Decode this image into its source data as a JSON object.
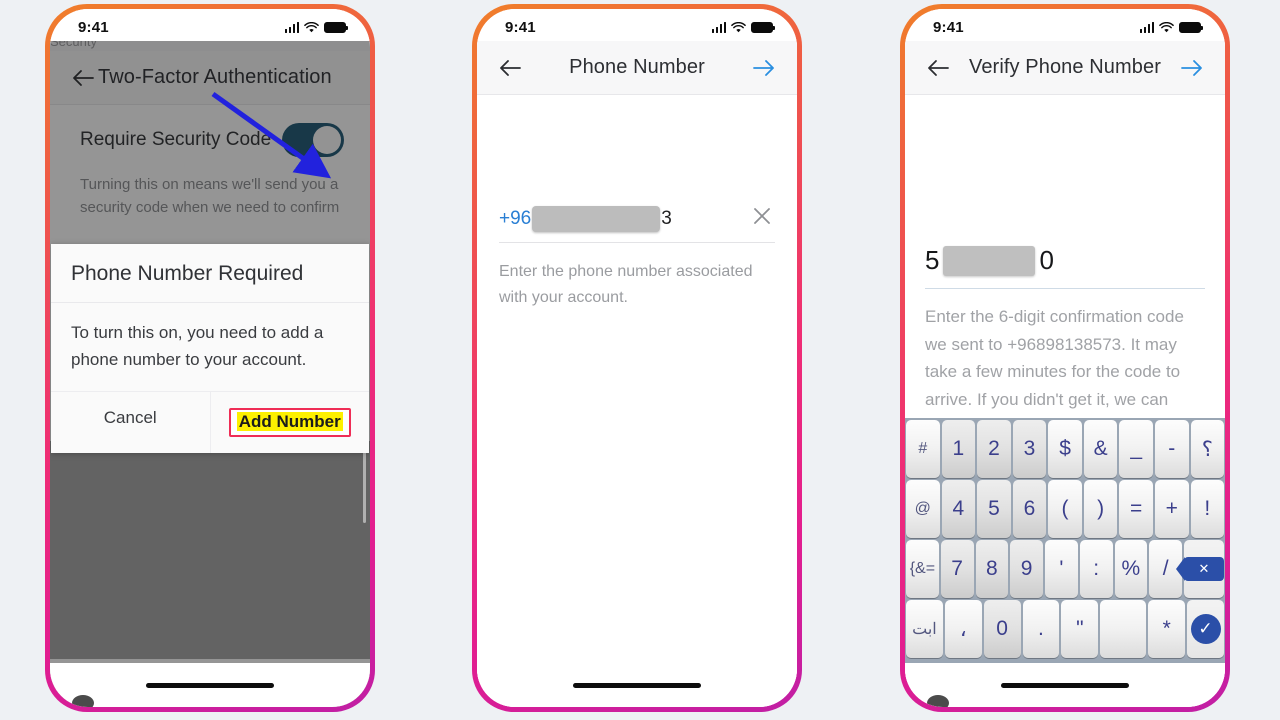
{
  "background_color": "#eef1f4",
  "frame_gradient": [
    "#f07f2a",
    "#ef2d75",
    "#c01fa5"
  ],
  "status_bar": {
    "time": "9:41",
    "signal_icon": "cellular-signal-icon",
    "wifi_icon": "wifi-icon",
    "battery_icon": "battery-icon"
  },
  "phone1": {
    "header": {
      "back_icon": "arrow-left-icon",
      "title": "Two-Factor Authentication"
    },
    "ghost_row_text": "Security",
    "toggle_row": {
      "label": "Require Security Code",
      "toggle_state": "on",
      "toggle_color": "#1d5673"
    },
    "help_text": "Turning this on means we'll send you a security code when we need to confirm",
    "annotation": {
      "type": "arrow",
      "color": "#2222dd",
      "points_to": "require-security-code-toggle"
    },
    "dialog": {
      "title": "Phone Number Required",
      "message": "To turn this on, you need to add a phone number to your account.",
      "cancel_label": "Cancel",
      "confirm_label": "Add Number",
      "confirm_highlight_color": "#fdf000",
      "confirm_box_color": "#ef2d56"
    }
  },
  "phone2": {
    "header": {
      "back_icon": "arrow-left-icon",
      "title": "Phone Number",
      "next_icon": "arrow-right-icon",
      "next_color": "#2a8fe0"
    },
    "field": {
      "prefix": "+96",
      "redacted": true,
      "suffix": "3",
      "clear_icon": "close-x-icon"
    },
    "help_text": "Enter the phone number associated with your account."
  },
  "phone3": {
    "header": {
      "back_icon": "arrow-left-icon",
      "title": "Verify Phone Number",
      "next_icon": "arrow-right-icon",
      "next_color": "#2a8fe0"
    },
    "code_field": {
      "prefix": "5",
      "redacted": true,
      "suffix": "0"
    },
    "help_text": "Enter the 6-digit confirmation code we sent to +96898138573. It may take a few minutes for the code to arrive. If you didn't get it, we can resend the code.",
    "keyboard": {
      "rows": [
        [
          {
            "label": "#",
            "kind": "fn"
          },
          {
            "label": "1",
            "kind": "num"
          },
          {
            "label": "2",
            "kind": "num"
          },
          {
            "label": "3",
            "kind": "num"
          },
          {
            "label": "$",
            "kind": "sym"
          },
          {
            "label": "&",
            "kind": "sym"
          },
          {
            "label": "_",
            "kind": "sym"
          },
          {
            "label": "-",
            "kind": "sym"
          },
          {
            "label": "؟",
            "kind": "sym"
          }
        ],
        [
          {
            "label": "@",
            "kind": "fn"
          },
          {
            "label": "4",
            "kind": "num"
          },
          {
            "label": "5",
            "kind": "num"
          },
          {
            "label": "6",
            "kind": "num"
          },
          {
            "label": "(",
            "kind": "sym"
          },
          {
            "label": ")",
            "kind": "sym"
          },
          {
            "label": "=",
            "kind": "sym"
          },
          {
            "label": "+",
            "kind": "sym"
          },
          {
            "label": "!",
            "kind": "sym"
          }
        ],
        [
          {
            "label": "{&=",
            "kind": "fn"
          },
          {
            "label": "7",
            "kind": "num"
          },
          {
            "label": "8",
            "kind": "num"
          },
          {
            "label": "9",
            "kind": "num"
          },
          {
            "label": "'",
            "kind": "sym"
          },
          {
            "label": ":",
            "kind": "sym"
          },
          {
            "label": "%",
            "kind": "sym"
          },
          {
            "label": "/",
            "kind": "sym"
          },
          {
            "label": "",
            "kind": "backspace",
            "icon": "backspace-icon"
          }
        ],
        [
          {
            "label": "ابت",
            "kind": "fn"
          },
          {
            "label": "،",
            "kind": "sym"
          },
          {
            "label": "0",
            "kind": "num"
          },
          {
            "label": ".",
            "kind": "sym"
          },
          {
            "label": "\"",
            "kind": "sym"
          },
          {
            "label": "",
            "kind": "space"
          },
          {
            "label": "*",
            "kind": "sym"
          },
          {
            "label": "",
            "kind": "confirm",
            "icon": "check-icon"
          }
        ]
      ]
    }
  }
}
